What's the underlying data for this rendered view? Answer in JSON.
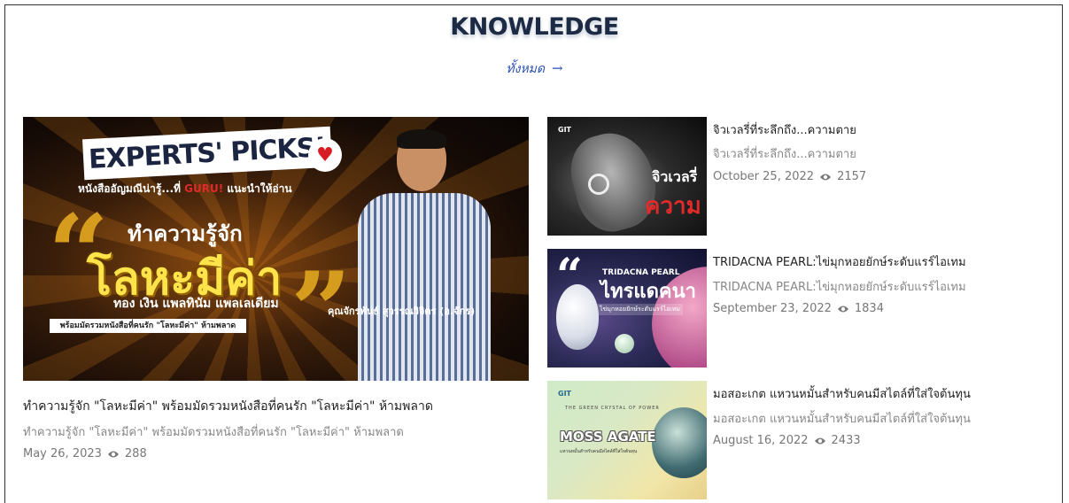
{
  "section": {
    "heading": "KNOWLEDGE",
    "view_all": "ทั้งหมด",
    "view_all_arrow": "→"
  },
  "featured": {
    "title": "ทำความรู้จัก \"โลหะมีค่า\" พร้อมมัดรวมหนังสือที่คนรัก \"โลหะมีค่า\" ห้ามพลาด",
    "subtitle": "ทำความรู้จัก \"โลหะมีค่า\" พร้อมมัดรวมหนังสือที่คนรัก \"โลหะมีค่า\" ห้ามพลาด",
    "date": "May 26, 2023",
    "views": "288",
    "image_text": {
      "banner": "EXPERTS' PICKS!",
      "subline_a": "หนังสืออัญมณีน่ารู้...ที่ ",
      "subline_guru": "GURU!",
      "subline_b": " แนะนำให้อ่าน",
      "line1": "ทำความรู้จัก",
      "line2": "โลหะมีค่า",
      "line3": "ทอง เงิน แพลทินัม แพลเลเดียม",
      "pill": "พร้อมมัดรวมหนังสือที่คนรัก \"โลหะมีค่า\" ห้ามพลาด",
      "person_name": "คุณจักรพันธ์ สุวรรณวิจิตร (อ.จักร)"
    }
  },
  "articles": [
    {
      "title": "จิวเวลรี่ที่ระลึกถึง...ความตาย",
      "subtitle": "จิวเวลรี่ที่ระลึกถึง...ความตาย",
      "date": "October 25, 2022",
      "views": "2157",
      "image_text": {
        "logo": "GIT",
        "line1": "จิวเวลรี่",
        "line2": "ความ"
      }
    },
    {
      "title": "TRIDACNA PEARL:ไข่มุกหอยยักษ์ระดับแรร์ไอเทม",
      "subtitle": "TRIDACNA PEARL:ไข่มุกหอยยักษ์ระดับแรร์ไอเทม",
      "date": "September 23, 2022",
      "views": "1834",
      "image_text": {
        "quote": "“",
        "small": "TRIDACNA PEARL",
        "big": "ไทรแดคนา",
        "tag": "ไข่มุกหอยยักษ์ระดับแรร์ไอเทม"
      }
    },
    {
      "title": "มอสอะเกต แหวนหมั้นสำหรับคนมีสไตล์ที่ใส่ใจต้นทุน",
      "subtitle": "มอสอะเกต แหวนหมั้นสำหรับคนมีสไตล์ที่ใส่ใจต้นทุน",
      "date": "August 16, 2022",
      "views": "2433",
      "image_text": {
        "logo": "GIT",
        "tagline": "THE GREEN CRYSTAL OF POWER",
        "big": "MOSS AGATE",
        "small": "แหวนหมั้นสำหรับคนมีสไตล์ที่ใส่ใจต้นทุน"
      }
    }
  ],
  "colors": {
    "heading": "#1d2a44",
    "link": "#2a4fb0",
    "muted": "#888888"
  },
  "icons": {
    "views": "eye-icon",
    "arrow": "arrow-right-icon"
  }
}
